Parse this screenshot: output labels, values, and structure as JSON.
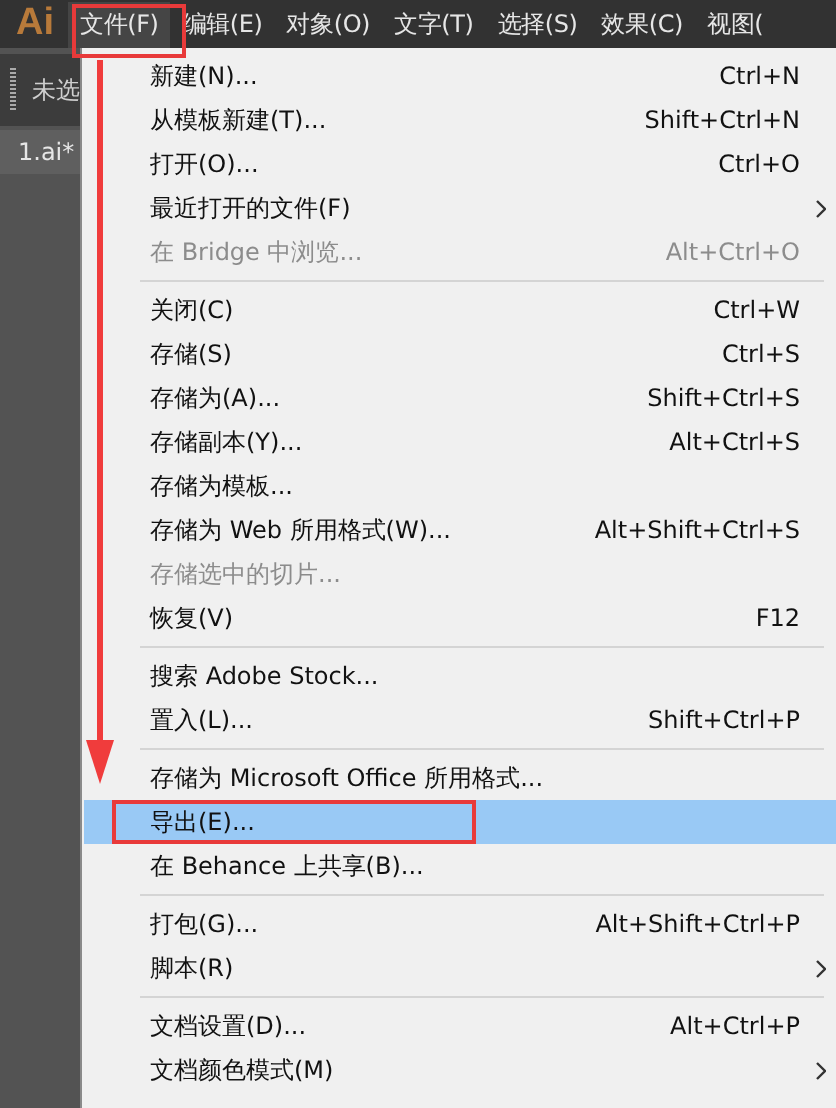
{
  "app": {
    "logo": "Ai"
  },
  "menubar": [
    {
      "label": "文件(F)",
      "selected": true
    },
    {
      "label": "编辑(E)",
      "selected": false
    },
    {
      "label": "对象(O)",
      "selected": false
    },
    {
      "label": "文字(T)",
      "selected": false
    },
    {
      "label": "选择(S)",
      "selected": false
    },
    {
      "label": "效果(C)",
      "selected": false
    },
    {
      "label": "视图(",
      "selected": false
    }
  ],
  "control_bar": {
    "label": "未选"
  },
  "document_tab": {
    "label": "1.ai*"
  },
  "file_menu": {
    "sections": [
      [
        {
          "label": "新建(N)...",
          "shortcut": "Ctrl+N",
          "submenu": false,
          "disabled": false,
          "selected": false
        },
        {
          "label": "从模板新建(T)...",
          "shortcut": "Shift+Ctrl+N",
          "submenu": false,
          "disabled": false,
          "selected": false
        },
        {
          "label": "打开(O)...",
          "shortcut": "Ctrl+O",
          "submenu": false,
          "disabled": false,
          "selected": false
        },
        {
          "label": "最近打开的文件(F)",
          "submenu": true,
          "disabled": false,
          "selected": false
        },
        {
          "label": "在 Bridge 中浏览...",
          "shortcut": "Alt+Ctrl+O",
          "submenu": false,
          "disabled": true,
          "selected": false
        }
      ],
      [
        {
          "label": "关闭(C)",
          "shortcut": "Ctrl+W",
          "submenu": false,
          "disabled": false,
          "selected": false
        },
        {
          "label": "存储(S)",
          "shortcut": "Ctrl+S",
          "submenu": false,
          "disabled": false,
          "selected": false
        },
        {
          "label": "存储为(A)...",
          "shortcut": "Shift+Ctrl+S",
          "submenu": false,
          "disabled": false,
          "selected": false
        },
        {
          "label": "存储副本(Y)...",
          "shortcut": "Alt+Ctrl+S",
          "submenu": false,
          "disabled": false,
          "selected": false
        },
        {
          "label": "存储为模板...",
          "submenu": false,
          "disabled": false,
          "selected": false
        },
        {
          "label": "存储为 Web 所用格式(W)...",
          "shortcut": "Alt+Shift+Ctrl+S",
          "submenu": false,
          "disabled": false,
          "selected": false
        },
        {
          "label": "存储选中的切片...",
          "submenu": false,
          "disabled": true,
          "selected": false
        },
        {
          "label": "恢复(V)",
          "shortcut": "F12",
          "submenu": false,
          "disabled": false,
          "selected": false
        }
      ],
      [
        {
          "label": "搜索 Adobe Stock...",
          "submenu": false,
          "disabled": false,
          "selected": false
        },
        {
          "label": "置入(L)...",
          "shortcut": "Shift+Ctrl+P",
          "submenu": false,
          "disabled": false,
          "selected": false
        }
      ],
      [
        {
          "label": "存储为 Microsoft Office 所用格式...",
          "submenu": false,
          "disabled": false,
          "selected": false
        },
        {
          "label": "导出(E)...",
          "submenu": false,
          "disabled": false,
          "selected": true
        },
        {
          "label": "在 Behance 上共享(B)...",
          "submenu": false,
          "disabled": false,
          "selected": false
        }
      ],
      [
        {
          "label": "打包(G)...",
          "shortcut": "Alt+Shift+Ctrl+P",
          "submenu": false,
          "disabled": false,
          "selected": false
        },
        {
          "label": "脚本(R)",
          "submenu": true,
          "disabled": false,
          "selected": false
        }
      ],
      [
        {
          "label": "文档设置(D)...",
          "shortcut": "Alt+Ctrl+P",
          "submenu": false,
          "disabled": false,
          "selected": false
        },
        {
          "label": "文档颜色模式(M)",
          "submenu": true,
          "disabled": false,
          "selected": false
        }
      ]
    ]
  }
}
